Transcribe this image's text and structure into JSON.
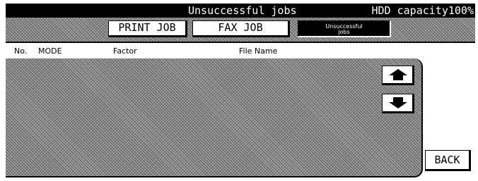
{
  "title_bar": {
    "title": "Unsuccessful jobs",
    "hdd_capacity": "HDD capacity100%"
  },
  "tabs": [
    {
      "label": "PRINT JOB",
      "selected": false
    },
    {
      "label": "FAX JOB",
      "selected": false
    },
    {
      "label": "Unsuccessful\njobs",
      "selected": true
    }
  ],
  "columns": {
    "no": "No.",
    "mode": "MODE",
    "factor": "Factor",
    "file_name": "File Name"
  },
  "job_rows": [],
  "scroll": {
    "up_icon": "arrow-up-icon",
    "down_icon": "arrow-down-icon"
  },
  "back_label": "BACK",
  "colors": {
    "title_bar_bg": "#000000",
    "hatch_base": "#8c8c8c"
  }
}
